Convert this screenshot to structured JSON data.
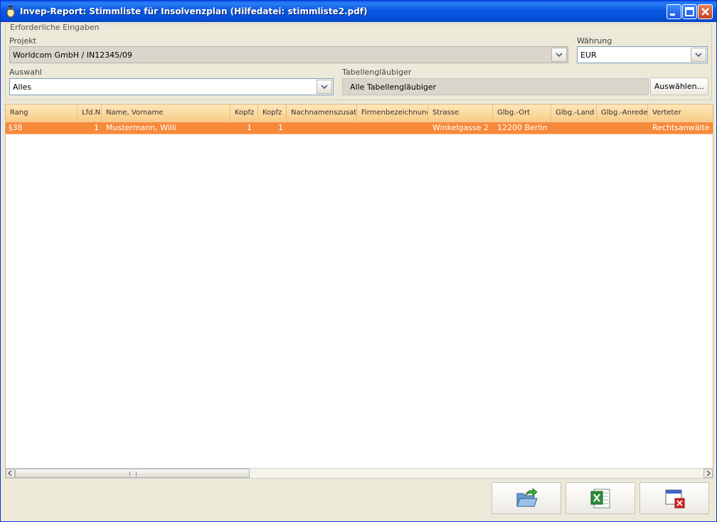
{
  "window": {
    "title": "Invep-Report: Stimmliste für Insolvenzplan   (Hilfedatei: stimmliste2.pdf)"
  },
  "group": {
    "legend": "Erforderliche Eingaben",
    "projekt_label": "Projekt",
    "projekt_value": "Worldcom GmbH / IN12345/09",
    "waehrung_label": "Währung",
    "waehrung_value": "EUR",
    "auswahl_label": "Auswahl",
    "auswahl_value": "Alles",
    "tabellen_label": "Tabellengläubiger",
    "tabellen_value": "Alle Tabellengläubiger",
    "auswaehlen_button": "Auswählen..."
  },
  "table": {
    "columns": [
      "Rang",
      "Lfd.N",
      "Name, Vorname",
      "Kopfz",
      "Kopfz",
      "Nachnamenszusatz",
      "Firmenbezeichnung",
      "Strasse",
      "Glbg.-Ort",
      "Glbg.-Land",
      "Glbg.-Anrede",
      "Verteter"
    ],
    "rows": [
      {
        "rang": "§38",
        "lfd": "1",
        "name": "Mustermann, Willi",
        "kopfz1": "1",
        "kopfz2": "1",
        "zusatz": "",
        "firma": "",
        "strasse": "Winkelgasse 2",
        "ort": "12200 Berlin",
        "land": "",
        "anrede": "",
        "vertreter": "Rechtsanwälte"
      }
    ]
  },
  "icons": {
    "export": "folder-export-icon",
    "excel": "excel-icon",
    "close": "window-close-icon"
  },
  "colors": {
    "selection": "#F7893A",
    "header": "#F7CC88",
    "titlebar": "#0A59E3"
  }
}
